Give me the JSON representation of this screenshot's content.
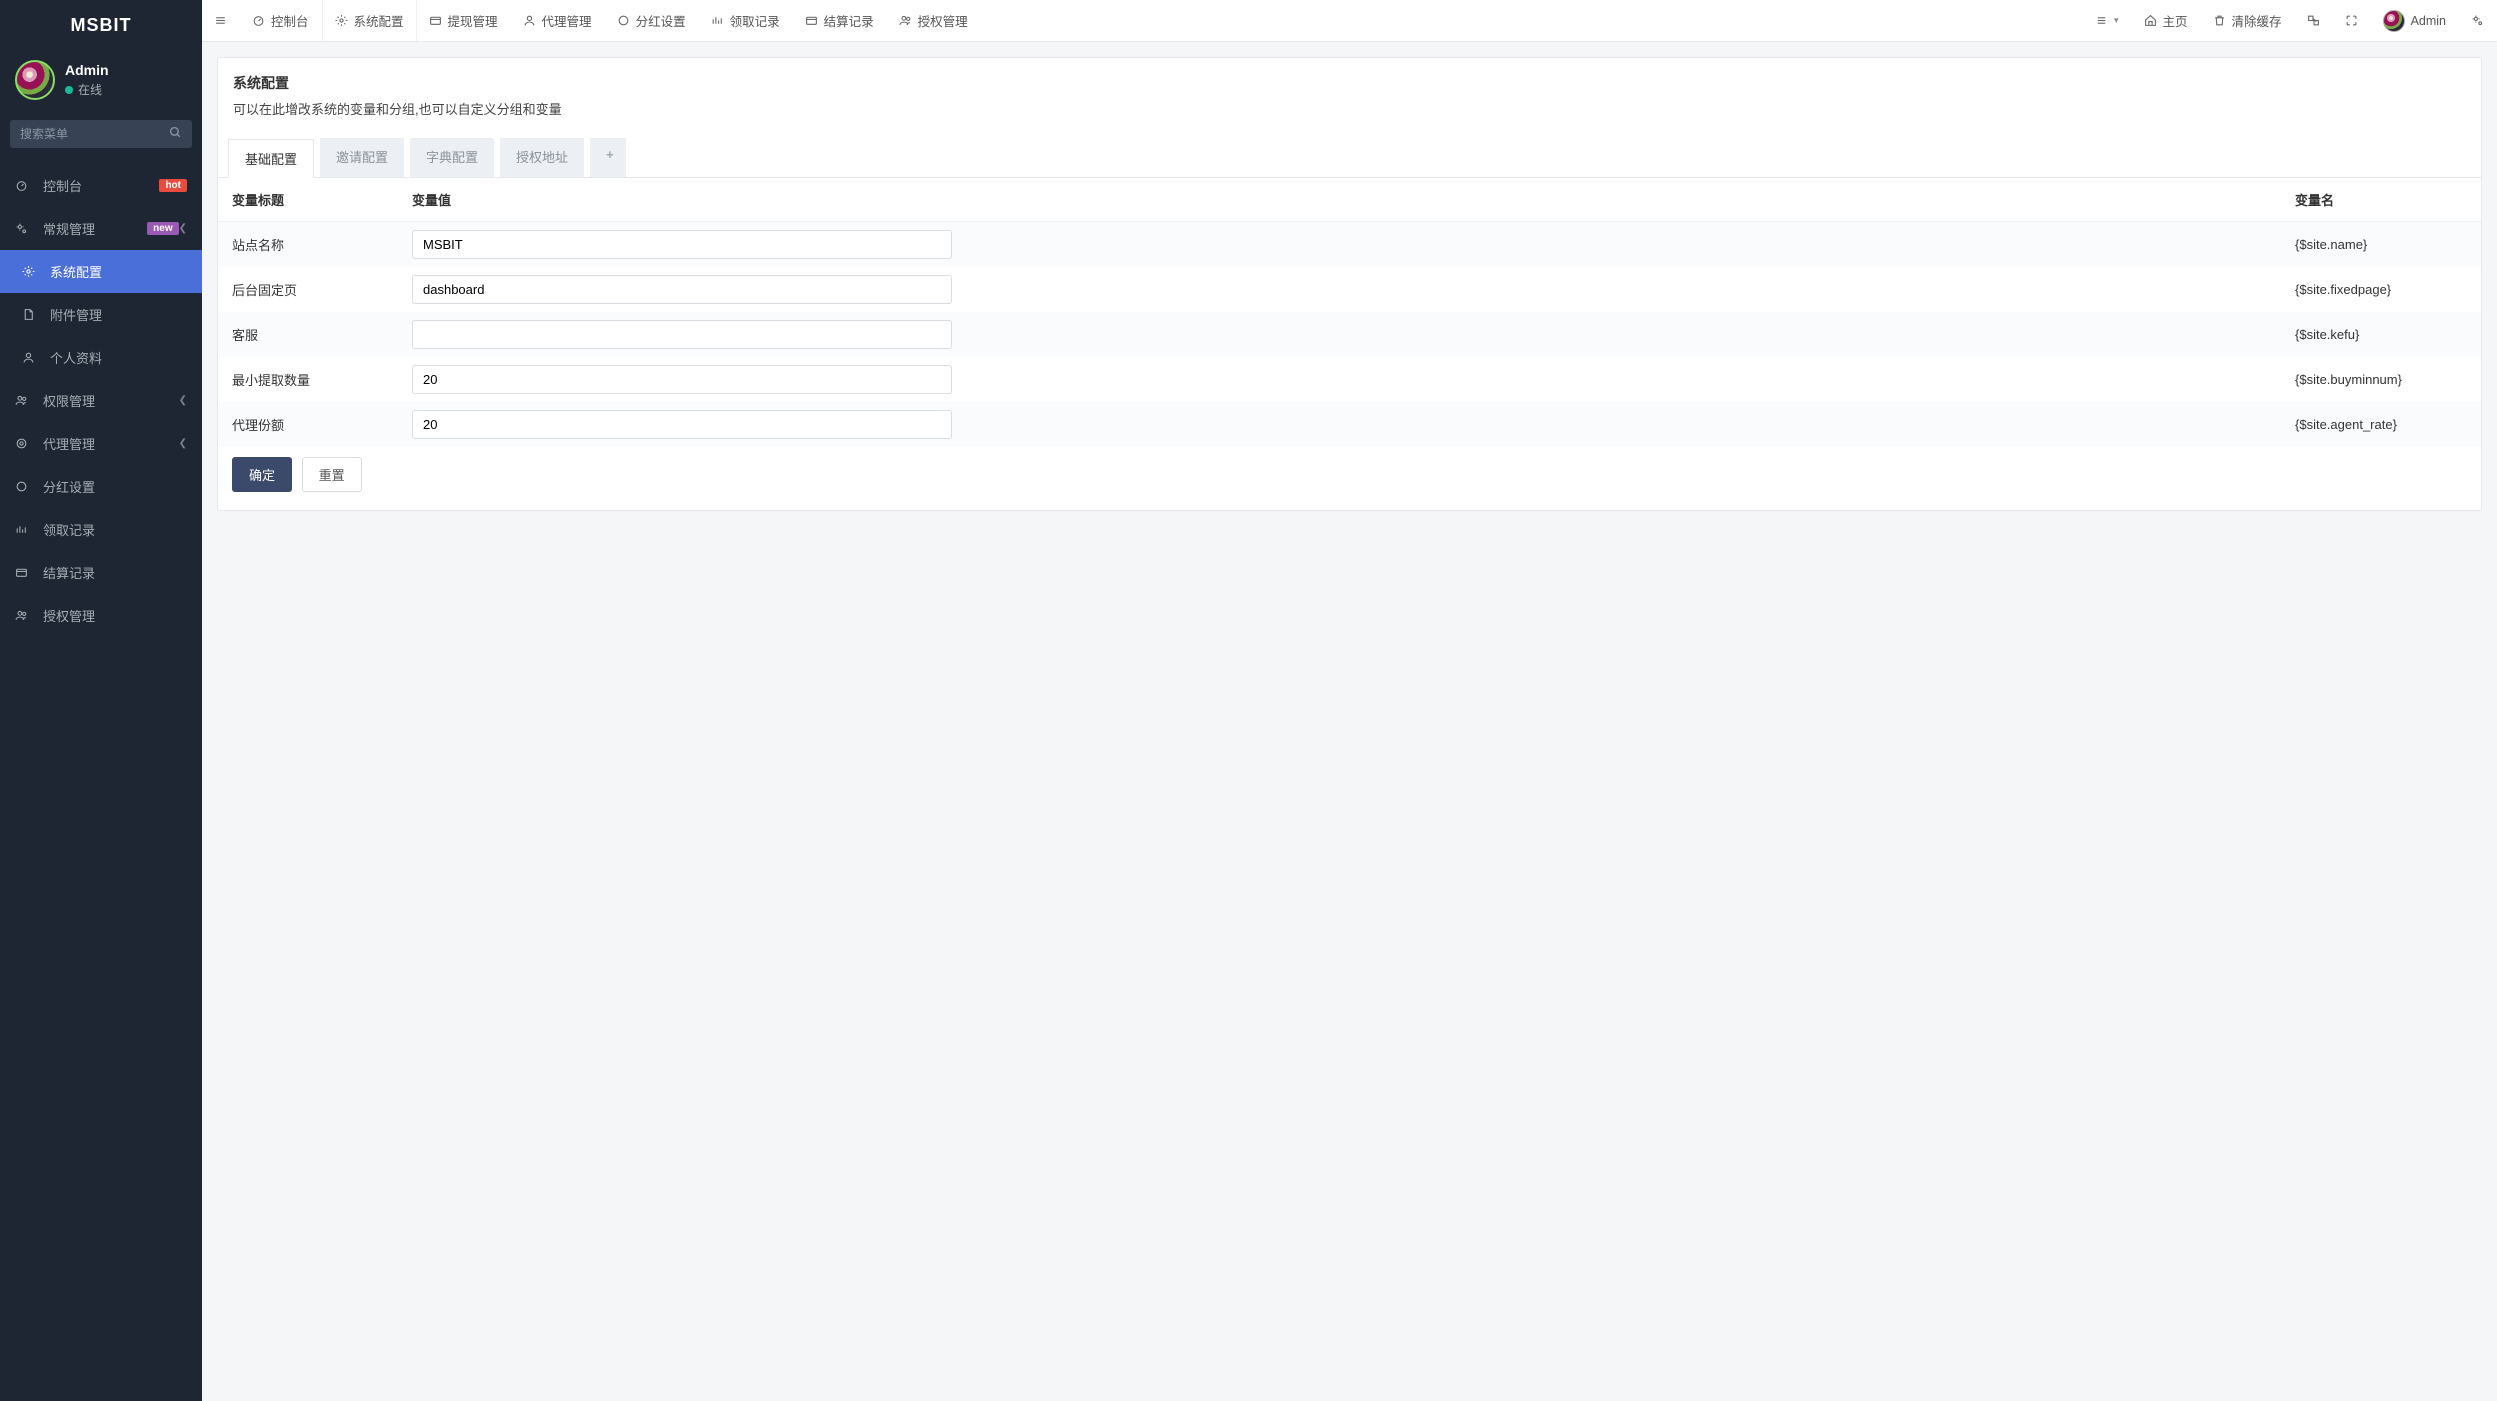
{
  "brand": "MSBIT",
  "user": {
    "name": "Admin",
    "status": "在线"
  },
  "search": {
    "placeholder": "搜索菜单"
  },
  "sidebar": [
    {
      "icon": "dashboard",
      "label": "控制台",
      "badge": "hot",
      "badgeText": "hot"
    },
    {
      "icon": "gears",
      "label": "常规管理",
      "badge": "new",
      "badgeText": "new",
      "expandable": true
    },
    {
      "icon": "gear",
      "label": "系统配置",
      "sub": true,
      "active": true
    },
    {
      "icon": "file",
      "label": "附件管理",
      "sub": true
    },
    {
      "icon": "user",
      "label": "个人资料",
      "sub": true
    },
    {
      "icon": "users",
      "label": "权限管理",
      "expandable": true
    },
    {
      "icon": "target",
      "label": "代理管理",
      "expandable": true
    },
    {
      "icon": "circle",
      "label": "分红设置"
    },
    {
      "icon": "bars",
      "label": "领取记录"
    },
    {
      "icon": "card",
      "label": "结算记录"
    },
    {
      "icon": "users",
      "label": "授权管理"
    }
  ],
  "topnav": [
    {
      "icon": "menu"
    },
    {
      "icon": "dashboard",
      "label": "控制台"
    },
    {
      "icon": "gear",
      "label": "系统配置",
      "active": true
    },
    {
      "icon": "card",
      "label": "提现管理"
    },
    {
      "icon": "user",
      "label": "代理管理"
    },
    {
      "icon": "circle",
      "label": "分红设置"
    },
    {
      "icon": "bars",
      "label": "领取记录"
    },
    {
      "icon": "card",
      "label": "结算记录"
    },
    {
      "icon": "users",
      "label": "授权管理"
    }
  ],
  "topright": [
    {
      "icon": "list",
      "caret": true
    },
    {
      "icon": "home",
      "label": "主页"
    },
    {
      "icon": "trash",
      "label": "清除缓存"
    },
    {
      "icon": "lang"
    },
    {
      "icon": "expand"
    },
    {
      "avatar": true,
      "label": "Admin"
    },
    {
      "icon": "gears"
    }
  ],
  "panel": {
    "title": "系统配置",
    "desc": "可以在此增改系统的变量和分组,也可以自定义分组和变量"
  },
  "tabs": [
    "基础配置",
    "邀请配置",
    "字典配置",
    "授权地址"
  ],
  "columns": {
    "title": "变量标题",
    "value": "变量值",
    "name": "变量名"
  },
  "rows": [
    {
      "title": "站点名称",
      "value": "MSBIT",
      "name": "{$site.name}"
    },
    {
      "title": "后台固定页",
      "value": "dashboard",
      "name": "{$site.fixedpage}"
    },
    {
      "title": "客服",
      "value": "",
      "name": "{$site.kefu}"
    },
    {
      "title": "最小提取数量",
      "value": "20",
      "name": "{$site.buyminnum}"
    },
    {
      "title": "代理份额",
      "value": "20",
      "name": "{$site.agent_rate}"
    }
  ],
  "buttons": {
    "ok": "确定",
    "reset": "重置"
  }
}
